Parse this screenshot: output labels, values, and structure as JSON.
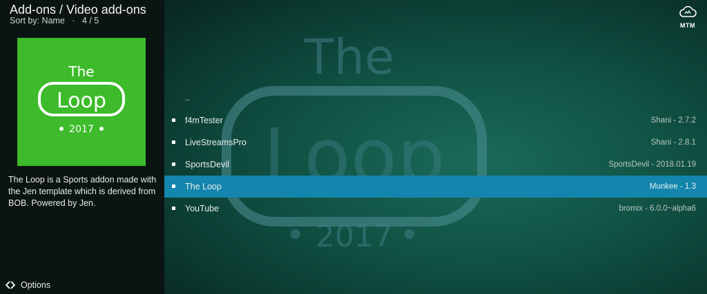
{
  "header": {
    "title": "Add-ons / Video add-ons",
    "sort": "Sort by: Name",
    "position": "4 / 5"
  },
  "addon": {
    "thumbnail_text_top": "The",
    "thumbnail_text_main": "Loop",
    "thumbnail_text_year": "2017",
    "description": "The Loop is a Sports addon made with the Jen template which is derived from BOB. Powered by Jen."
  },
  "footer": {
    "options_label": "Options"
  },
  "logo": {
    "text": "MTM"
  },
  "list": {
    "parent_label": "..",
    "items": [
      {
        "name": "f4mTester",
        "version": "Shani - 2.7.2"
      },
      {
        "name": "LiveStreamsPro",
        "version": "Shani - 2.8.1"
      },
      {
        "name": "SportsDevil",
        "version": "SportsDevil - 2018.01.19"
      },
      {
        "name": "The Loop",
        "version": "Munkee - 1.3"
      },
      {
        "name": "YouTube",
        "version": "bromix - 6.0.0~alpha6"
      }
    ]
  },
  "colors": {
    "selection": "#1485ad",
    "thumbnail_bg": "#3dbb2b",
    "background": "#115446"
  }
}
